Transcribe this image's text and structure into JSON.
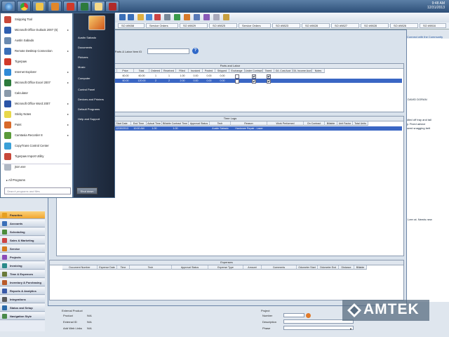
{
  "taskbar": {
    "clock_time": "9:48 AM",
    "clock_date": "12/31/2013",
    "buttons": [
      "start-orb",
      "chrome",
      "folder",
      "thunderbird",
      "tigerpaw",
      "excel",
      "explorer",
      "acrobat",
      "vmware"
    ]
  },
  "tabs": [
    "SO #9658",
    "Service Orders",
    "SO #9829",
    "SO #9825",
    "Service Orders",
    "SO #9823",
    "SO #9828",
    "SO #9827",
    "SO #9828",
    "SO #9826",
    "SO #9816"
  ],
  "right_link": "Connect with the Community",
  "right_panel_text": [
    "s DAVID DORAN",
    "rolled off tray and tail",
    "sy. Fixed advice",
    "eared snagging belt",
    "s Leer at. Needs new"
  ],
  "search": {
    "label": "Search Parts & Labor Item ID",
    "value": ""
  },
  "parts_grid": {
    "title": "Parts and Labor",
    "headers": [
      "Item ID",
      "Description",
      "Qty",
      "Price",
      "Total",
      "Ordered",
      "Received",
      "Filled",
      "Invoiced",
      "Posted",
      "Shipped",
      "Exchange",
      "Under Contract",
      "Taxed",
      "G/L Cost Acct",
      "G/L Income Acct",
      "Notes"
    ],
    "rows": [
      {
        "id": "",
        "desc": "Diagnostic",
        "qty": "1.00",
        "price": "60.00",
        "total": "60.00",
        "ordered": "1",
        "received": "1",
        "filled": "1.00",
        "invoiced": "0.00",
        "posted": "0.00",
        "shipped": "0.00",
        "selected": false
      },
      {
        "id": "",
        "desc": "Magnetic Paper Feed",
        "qty": "2.00",
        "price": "60.00",
        "total": "120.00",
        "ordered": "2",
        "received": "2",
        "filled": "2.00",
        "invoiced": "0.00",
        "posted": "0.00",
        "shipped": "0.00",
        "selected": true
      }
    ]
  },
  "time_grid": {
    "title": "Time Logs",
    "headers": [
      "Start Date",
      "End Time",
      "Actual Time",
      "Billable Contract Time",
      "Approval Status",
      "Tech",
      "Reason",
      "Work Performed",
      "On Contract",
      "Billable",
      "Unit Factor",
      "Total Units"
    ],
    "rows": [
      {
        "start": "12/30/2013",
        "end": "10:00 AM",
        "actual": "1.00",
        "billable": "1.00",
        "approval": "",
        "tech": "Austin Sabado",
        "reason": "Hardware Repair - Laser",
        "work": ""
      }
    ]
  },
  "expense_grid": {
    "title": "Expenses",
    "headers": [
      "Document Number",
      "Expense Date",
      "Time",
      "Tech",
      "Approval Status",
      "Expense Type",
      "Amount",
      "Comments",
      "Odometer Start",
      "Odometer End",
      "Distance",
      "Billable"
    ]
  },
  "bottom_left": {
    "external_product_label": "External Product",
    "product_label": "Product",
    "product_value": "N/A",
    "external_id_label": "External ID",
    "external_id_value": "N/A",
    "web_links_label": "Add Web Links",
    "web_links_value": "N/A"
  },
  "project": {
    "section_label": "Project",
    "number_label": "Number",
    "description_label": "Description",
    "phase_label": "Phase"
  },
  "left_nav": [
    {
      "label": "Favorites",
      "color": "#e6a020",
      "active": true
    },
    {
      "label": "Accounts",
      "color": "#3a6fb8"
    },
    {
      "label": "Scheduling",
      "color": "#4c8c3c"
    },
    {
      "label": "Sales & Marketing",
      "color": "#c44"
    },
    {
      "label": "Service",
      "color": "#d47b1c"
    },
    {
      "label": "Projects",
      "color": "#8a4cb8"
    },
    {
      "label": "Invoicing",
      "color": "#2a8a8a"
    },
    {
      "label": "Time & Expenses",
      "color": "#6a7a3a"
    },
    {
      "label": "Inventory & Purchasing",
      "color": "#b85a2a"
    },
    {
      "label": "Reports & Analytics",
      "color": "#3a5aa8"
    },
    {
      "label": "Integrations",
      "color": "#5a5a5a"
    },
    {
      "label": "Status and Setup",
      "color": "#2a6aa8"
    },
    {
      "label": "Navigation Style",
      "color": "#4a8a4a"
    }
  ],
  "start_menu": {
    "programs": [
      {
        "label": "Snipping Tool",
        "color": "#c8483a",
        "arrow": false
      },
      {
        "label": "Microsoft Office Outlook 2007 (6)",
        "color": "#2f5fb0",
        "arrow": true
      },
      {
        "label": "Austin Sabado",
        "color": "#6a8ab0",
        "arrow": false
      },
      {
        "label": "Remote Desktop Connection",
        "color": "#3a6fb8",
        "arrow": true
      },
      {
        "label": "Tigerpaw",
        "color": "#d03a2a",
        "arrow": false
      },
      {
        "label": "Internet Explorer",
        "color": "#2f8ad8",
        "arrow": true
      },
      {
        "label": "Microsoft Office Excel 2007",
        "color": "#2c7a3c",
        "arrow": true
      },
      {
        "label": "Calculator",
        "color": "#8a9aaa",
        "arrow": false
      },
      {
        "label": "Microsoft Office Word 2007",
        "color": "#2a55a8",
        "arrow": true
      },
      {
        "label": "Sticky Notes",
        "color": "#e8d84a",
        "arrow": true
      },
      {
        "label": "Paint",
        "color": "#d86a2a",
        "arrow": true
      },
      {
        "label": "Camtasia Recorder 8",
        "color": "#5a9a3a",
        "arrow": true
      },
      {
        "label": "CopyTrans Control Center",
        "color": "#3aa0d8",
        "arrow": false
      },
      {
        "label": "Tigerpaw Import Utility",
        "color": "#c8483a",
        "arrow": false
      },
      {
        "label": "json.exe",
        "color": "#b0b8c4",
        "arrow": false
      }
    ],
    "all_programs": "All Programs",
    "search_placeholder": "Search programs and files",
    "right_items": [
      {
        "label": "Austin Sabado",
        "arrow": false
      },
      {
        "label": "Documents",
        "arrow": false
      },
      {
        "label": "Pictures",
        "arrow": false
      },
      {
        "label": "Music",
        "arrow": false
      },
      {
        "label": "Computer",
        "arrow": false
      },
      {
        "label": "Control Panel",
        "arrow": false
      },
      {
        "label": "Devices and Printers",
        "arrow": false
      },
      {
        "label": "Default Programs",
        "arrow": false
      },
      {
        "label": "Help and Support",
        "arrow": false
      }
    ],
    "shutdown": "Shut down"
  },
  "watermark": "AMTEK"
}
